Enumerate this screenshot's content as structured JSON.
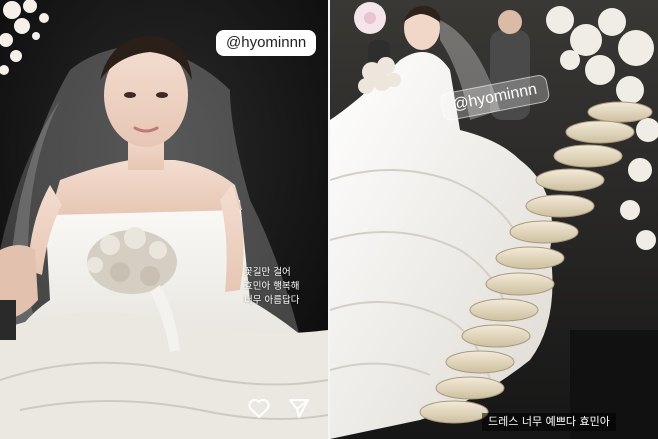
{
  "left_story": {
    "mention": "@hyominnn",
    "caption_lines": [
      "꽃길만 걸어",
      "효민아 행복해",
      "너무 아름답다"
    ],
    "icons": [
      "heart-icon",
      "send-icon"
    ]
  },
  "right_story": {
    "mention": "@hyominnn",
    "caption": "드레스 너무 예쁘다 효민아"
  },
  "colors": {
    "stage_background": "#0c0c0c",
    "dress_white": "#f2f0ec",
    "veil": "#ffffff",
    "bouquet": "#d8d2c8",
    "mushroom_cap": "#e8dcc6"
  }
}
